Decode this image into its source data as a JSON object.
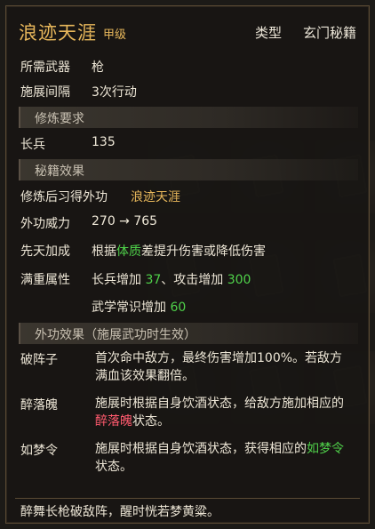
{
  "skill": {
    "title": "浪迹天涯",
    "grade": "甲级",
    "type_label": "类型",
    "type_value": "玄门秘籍"
  },
  "basic": {
    "weapon_label": "所需武器",
    "weapon_value": "枪",
    "interval_label": "施展间隔",
    "interval_value": "3次行动"
  },
  "requirements": {
    "header": "修炼要求",
    "stat_label": "长兵",
    "stat_value": "135"
  },
  "effects": {
    "header": "秘籍效果",
    "learn_label": "修炼后习得外功",
    "learn_value": "浪迹天涯",
    "power_label": "外功威力",
    "power_value": "270 → 765",
    "innate_label": "先天加成",
    "innate_pre": "根据",
    "innate_highlight": "体质",
    "innate_post": "差提升伤害或降低伤害",
    "full_label": "满重属性",
    "full_line1_a": "长兵增加 ",
    "full_line1_b": "37",
    "full_line1_c": "、攻击增加 ",
    "full_line1_d": "300",
    "full_line2_a": "武学常识增加 ",
    "full_line2_b": "60"
  },
  "skill_effects": {
    "header": "外功效果（施展武功时生效）",
    "items": [
      {
        "name": "破阵子",
        "line1": "首次命中敌方，最终伤害增加100%。若敌方",
        "line2": "满血该效果翻倍。"
      },
      {
        "name": "醉落魄",
        "line1": "施展时根据自身饮酒状态，给敌方施加相应的",
        "line2_highlight": "醉落魄",
        "line2_post": "状态。"
      },
      {
        "name": "如梦令",
        "line1_pre": "施展时根据自身饮酒状态，获得相应的",
        "line1_highlight": "如梦令",
        "line2": "状态。"
      }
    ]
  },
  "flavor": "醉舞长枪破敌阵，醒时恍若梦黄粱。",
  "colors": {
    "title": "#e7b75b",
    "highlight_green": "#4fd14a",
    "highlight_red": "#ff5a6e",
    "text": "#ede6d6"
  }
}
